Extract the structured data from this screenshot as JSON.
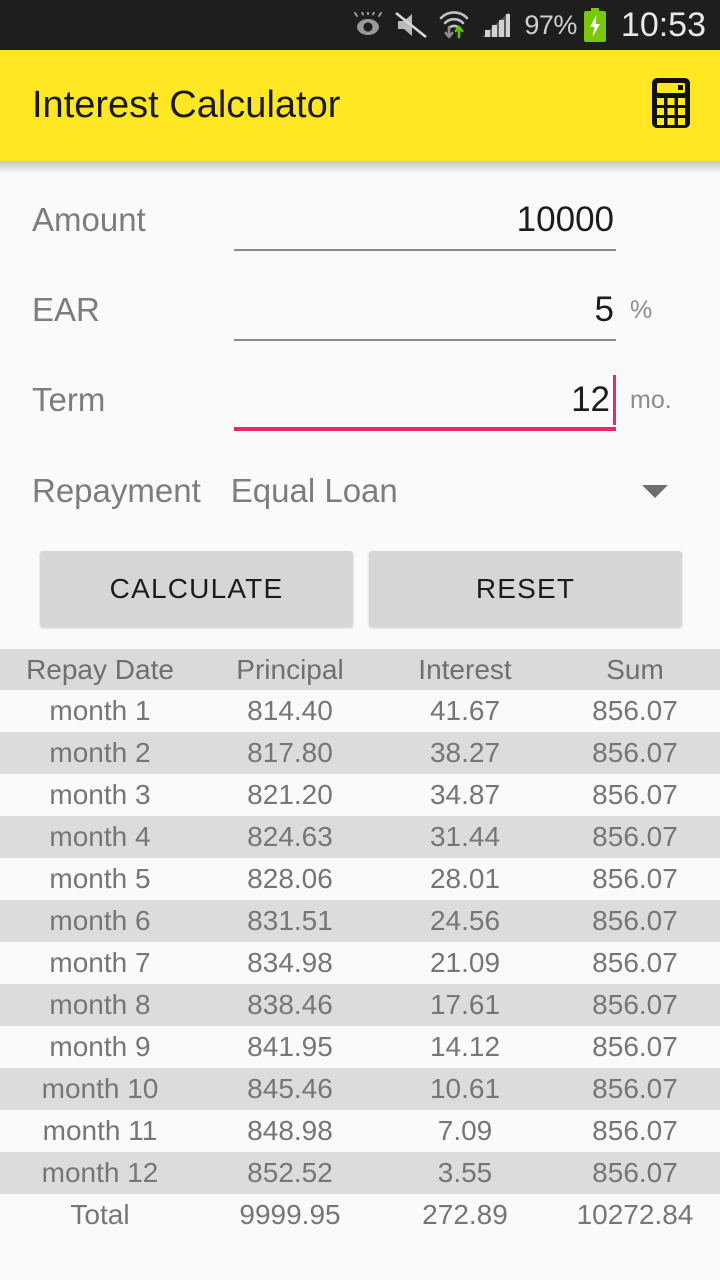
{
  "status_bar": {
    "icons": [
      "smart-stay-eye-icon",
      "sound-muted-icon",
      "wifi-transfer-icon",
      "cellular-signal-icon"
    ],
    "battery_percent": "97%",
    "battery_state": "charging",
    "clock": "10:53"
  },
  "app_bar": {
    "title": "Interest Calculator",
    "action_icon": "calculator-icon",
    "background_color": "#ffe723"
  },
  "form": {
    "fields": [
      {
        "label": "Amount",
        "value": "10000",
        "suffix": "",
        "focused": false
      },
      {
        "label": "EAR",
        "value": "5",
        "suffix": "%",
        "focused": false
      },
      {
        "label": "Term",
        "value": "12",
        "suffix": "mo.",
        "focused": true
      }
    ],
    "repayment": {
      "label": "Repayment",
      "selected": "Equal Loan"
    },
    "buttons": {
      "calculate": "CALCULATE",
      "reset": "RESET"
    },
    "focus_color": "#ec256f"
  },
  "table": {
    "headers": [
      "Repay Date",
      "Principal",
      "Interest",
      "Sum"
    ],
    "rows": [
      [
        "month 1",
        "814.40",
        "41.67",
        "856.07"
      ],
      [
        "month 2",
        "817.80",
        "38.27",
        "856.07"
      ],
      [
        "month 3",
        "821.20",
        "34.87",
        "856.07"
      ],
      [
        "month 4",
        "824.63",
        "31.44",
        "856.07"
      ],
      [
        "month 5",
        "828.06",
        "28.01",
        "856.07"
      ],
      [
        "month 6",
        "831.51",
        "24.56",
        "856.07"
      ],
      [
        "month 7",
        "834.98",
        "21.09",
        "856.07"
      ],
      [
        "month 8",
        "838.46",
        "17.61",
        "856.07"
      ],
      [
        "month 9",
        "841.95",
        "14.12",
        "856.07"
      ],
      [
        "month 10",
        "845.46",
        "10.61",
        "856.07"
      ],
      [
        "month 11",
        "848.98",
        "7.09",
        "856.07"
      ],
      [
        "month 12",
        "852.52",
        "3.55",
        "856.07"
      ]
    ],
    "total_row": [
      "Total",
      "9999.95",
      "272.89",
      "10272.84"
    ]
  }
}
